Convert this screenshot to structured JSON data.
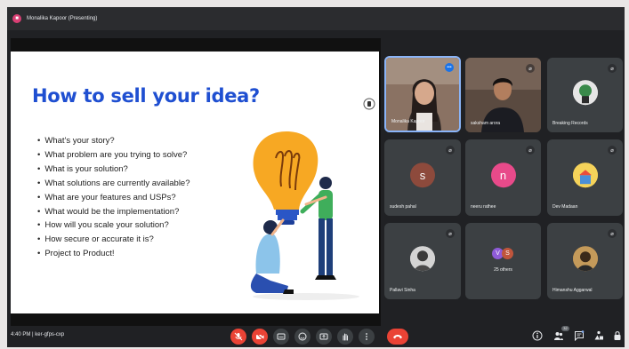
{
  "top_bar": {
    "presenter_label": "Monalika Kapoor (Presenting)"
  },
  "slide": {
    "title": "How to sell your idea?",
    "bullets": [
      "What's your story?",
      "What problem are you trying to solve?",
      "What is your solution?",
      "What solutions are currently available?",
      "What are your features and USPs?",
      "What would be the implementation?",
      "How will you scale your solution?",
      "How secure or accurate it is?",
      "Project to Product!"
    ]
  },
  "participants": [
    {
      "name": "Monalika Kapoor",
      "kind": "video",
      "active": true
    },
    {
      "name": "saksham arora",
      "kind": "video"
    },
    {
      "name": "Breaking Records",
      "kind": "avatar",
      "color": "#5f6368"
    },
    {
      "name": "sudesh pahal",
      "kind": "letter",
      "letter": "s",
      "color": "#8d4a3c"
    },
    {
      "name": "neeru rathee",
      "kind": "letter",
      "letter": "n",
      "color": "#e84a8a"
    },
    {
      "name": "Dev Madaan",
      "kind": "avatar",
      "color": "#f2c94c"
    },
    {
      "name": "Pallavi Sinha",
      "kind": "avatar",
      "color": "#707070"
    },
    {
      "name": "25 others",
      "kind": "others",
      "letters": [
        "V",
        "S"
      ],
      "colors": [
        "#8f5bd9",
        "#c0553c"
      ]
    },
    {
      "name": "Himanshu Aggarwal",
      "kind": "avatar",
      "color": "#b07a3a"
    }
  ],
  "bottom_bar": {
    "meeting_info": "4:40 PM  |  ker-gfps-cxp",
    "people_count": "32"
  },
  "colors": {
    "title_blue": "#1f4fd1",
    "danger_red": "#ea4335",
    "tile_bg": "#3c4043",
    "active_border": "#8ab4f8"
  },
  "icons": {
    "mic": "mic-off-icon",
    "camera": "camera-off-icon",
    "captions": "captions-icon",
    "emoji": "emoji-icon",
    "present": "present-screen-icon",
    "hand": "raise-hand-icon",
    "more": "more-options-icon",
    "hangup": "hang-up-icon",
    "info": "info-icon",
    "people": "people-icon",
    "chat": "chat-icon",
    "activities": "activities-icon",
    "lock": "host-controls-icon"
  }
}
